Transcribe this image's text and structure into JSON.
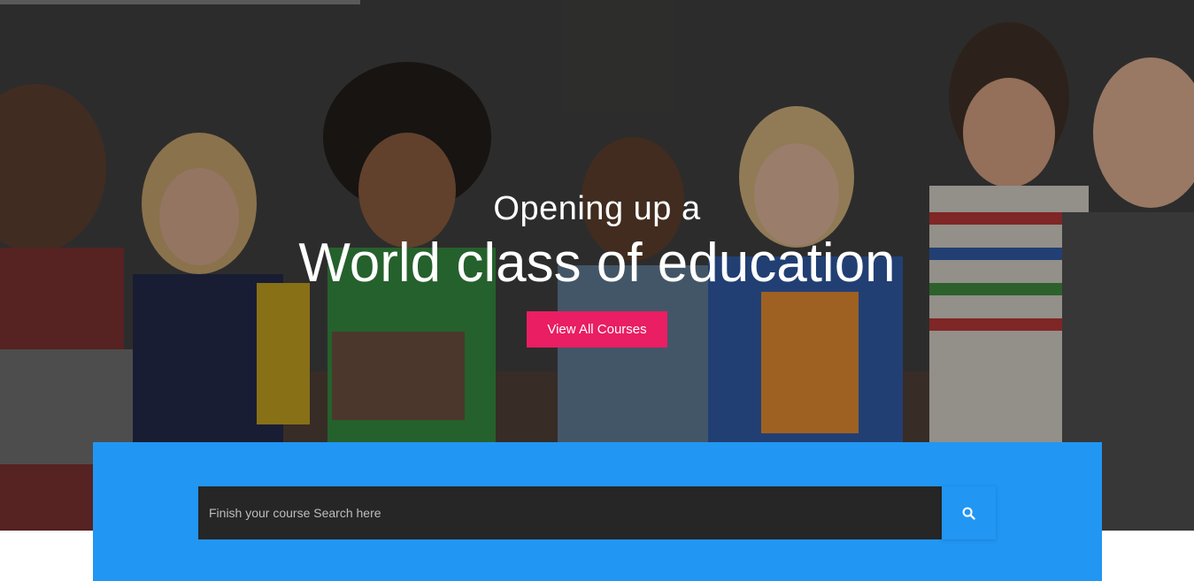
{
  "hero": {
    "subtitle": "Opening up a",
    "title": "World class of education",
    "cta_label": "View All Courses"
  },
  "search": {
    "placeholder": "Finish your course Search here",
    "button_icon": "search-icon"
  },
  "colors": {
    "accent": "#e91e63",
    "panel": "#2196f3",
    "input_bg": "#262626"
  }
}
